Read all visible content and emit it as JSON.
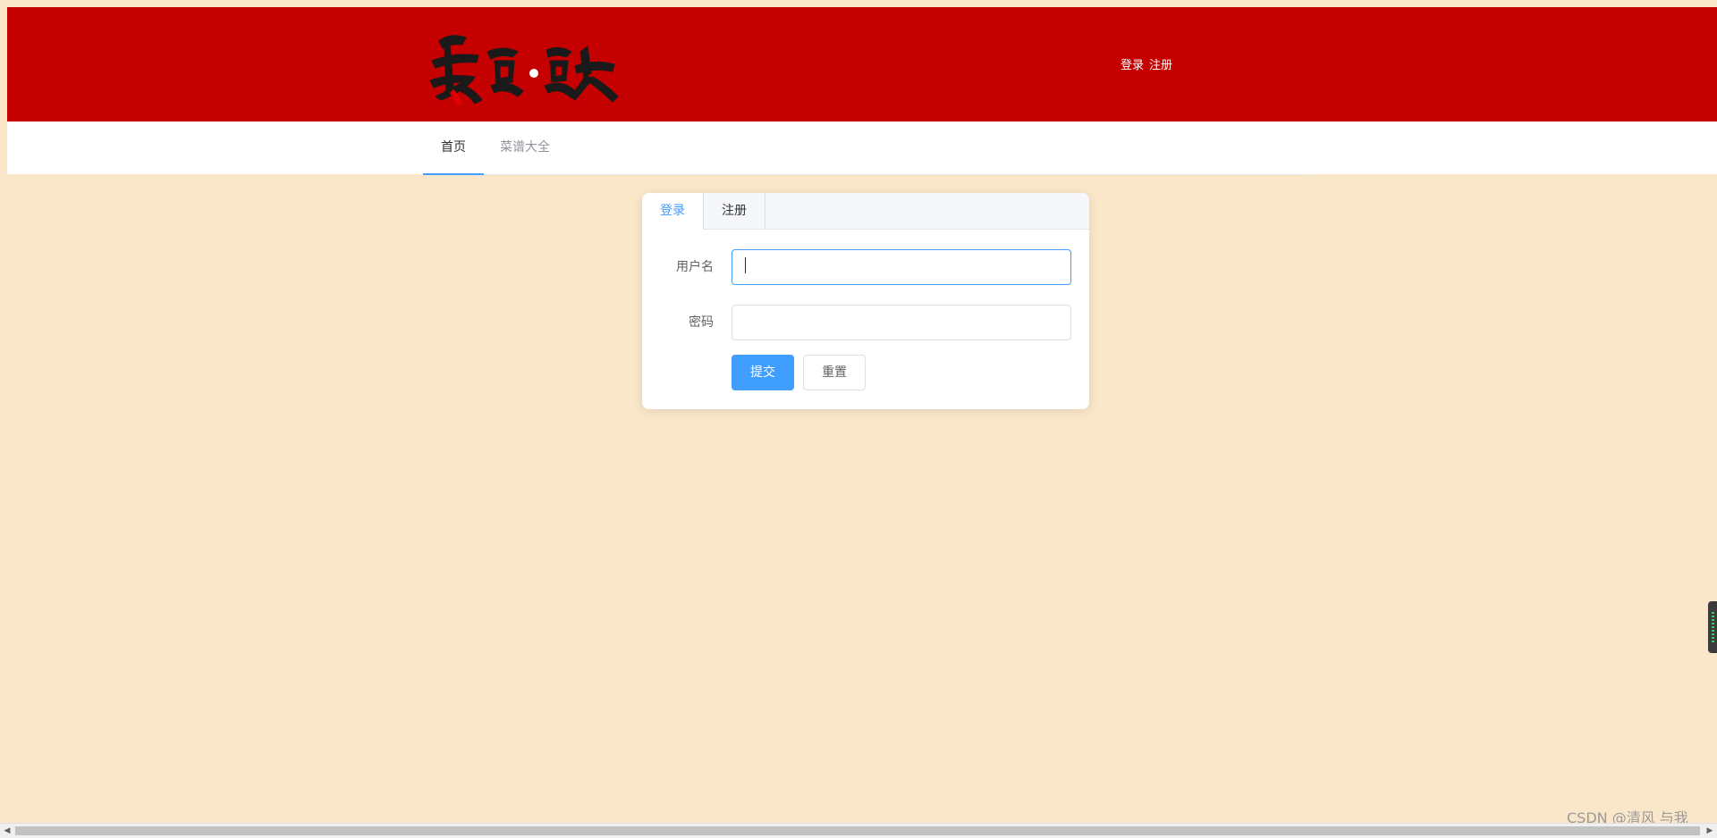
{
  "header": {
    "logo_text": "美食·食杰",
    "login_link": "登录",
    "register_link": "注册",
    "brand_color": "#c40000"
  },
  "nav": {
    "items": [
      {
        "label": "首页",
        "active": true
      },
      {
        "label": "菜谱大全",
        "active": false
      }
    ],
    "accent_color": "#409eff"
  },
  "login_form": {
    "tabs": [
      {
        "label": "登录",
        "active": true
      },
      {
        "label": "注册",
        "active": false
      }
    ],
    "username_label": "用户名",
    "username_value": "",
    "password_label": "密码",
    "password_value": "",
    "submit_label": "提交",
    "reset_label": "重置",
    "primary_color": "#409eff"
  },
  "page": {
    "background_color": "#fae7c9"
  },
  "overlay": {
    "watermark": "CSDN @清风 与我"
  }
}
